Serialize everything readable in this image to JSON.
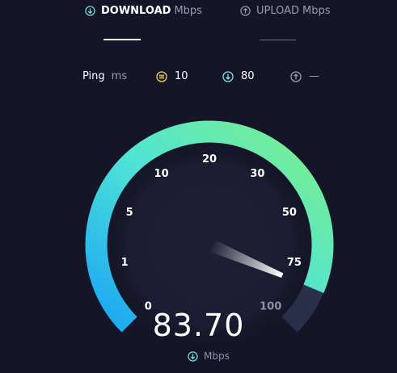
{
  "tabs": {
    "download": {
      "label": "DOWNLOAD",
      "unit": "Mbps",
      "icon": "download-arrow-icon",
      "active": true
    },
    "upload": {
      "label": "UPLOAD",
      "unit": "Mbps",
      "icon": "upload-arrow-icon",
      "active": false
    }
  },
  "ping": {
    "label": "Ping",
    "unit": "ms",
    "jitter": {
      "icon": "jitter-icon",
      "value": "10",
      "color": "#f5d55a"
    },
    "download": {
      "icon": "download-arrow-icon",
      "value": "80",
      "color": "#7de3e8"
    },
    "upload": {
      "icon": "upload-arrow-icon",
      "value": "—",
      "color": "#9a9cb4"
    }
  },
  "gauge": {
    "scale": [
      "0",
      "1",
      "5",
      "10",
      "20",
      "30",
      "50",
      "75",
      "100"
    ],
    "needle_value_mbps": 83.7,
    "speed": "83.70",
    "unit": "Mbps",
    "colors": {
      "start": "#1aa4f5",
      "end": "#7ef08a",
      "track": "#2a2f4a"
    }
  }
}
